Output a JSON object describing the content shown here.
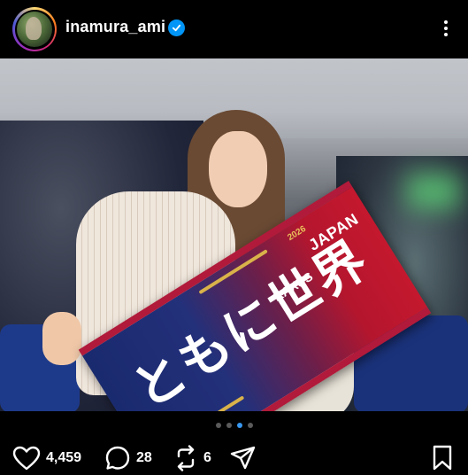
{
  "header": {
    "username": "inamura_ami",
    "verified_icon": "verified-badge-icon",
    "more_icon": "more-options-icon"
  },
  "post": {
    "towel_text": "ともに世界",
    "towel_brand": "JAPAN",
    "towel_sponsor": "RAXUS",
    "towel_year": "2026",
    "carousel": {
      "total": 4,
      "active_index": 2
    }
  },
  "actions": {
    "likes": "4,459",
    "comments": "28",
    "reposts": "6",
    "like_icon": "heart-icon",
    "comment_icon": "comment-icon",
    "repost_icon": "repost-icon",
    "share_icon": "share-icon",
    "save_icon": "bookmark-icon"
  },
  "colors": {
    "verified": "#0095f6",
    "carousel_active": "#3897f0",
    "background": "#000000"
  }
}
